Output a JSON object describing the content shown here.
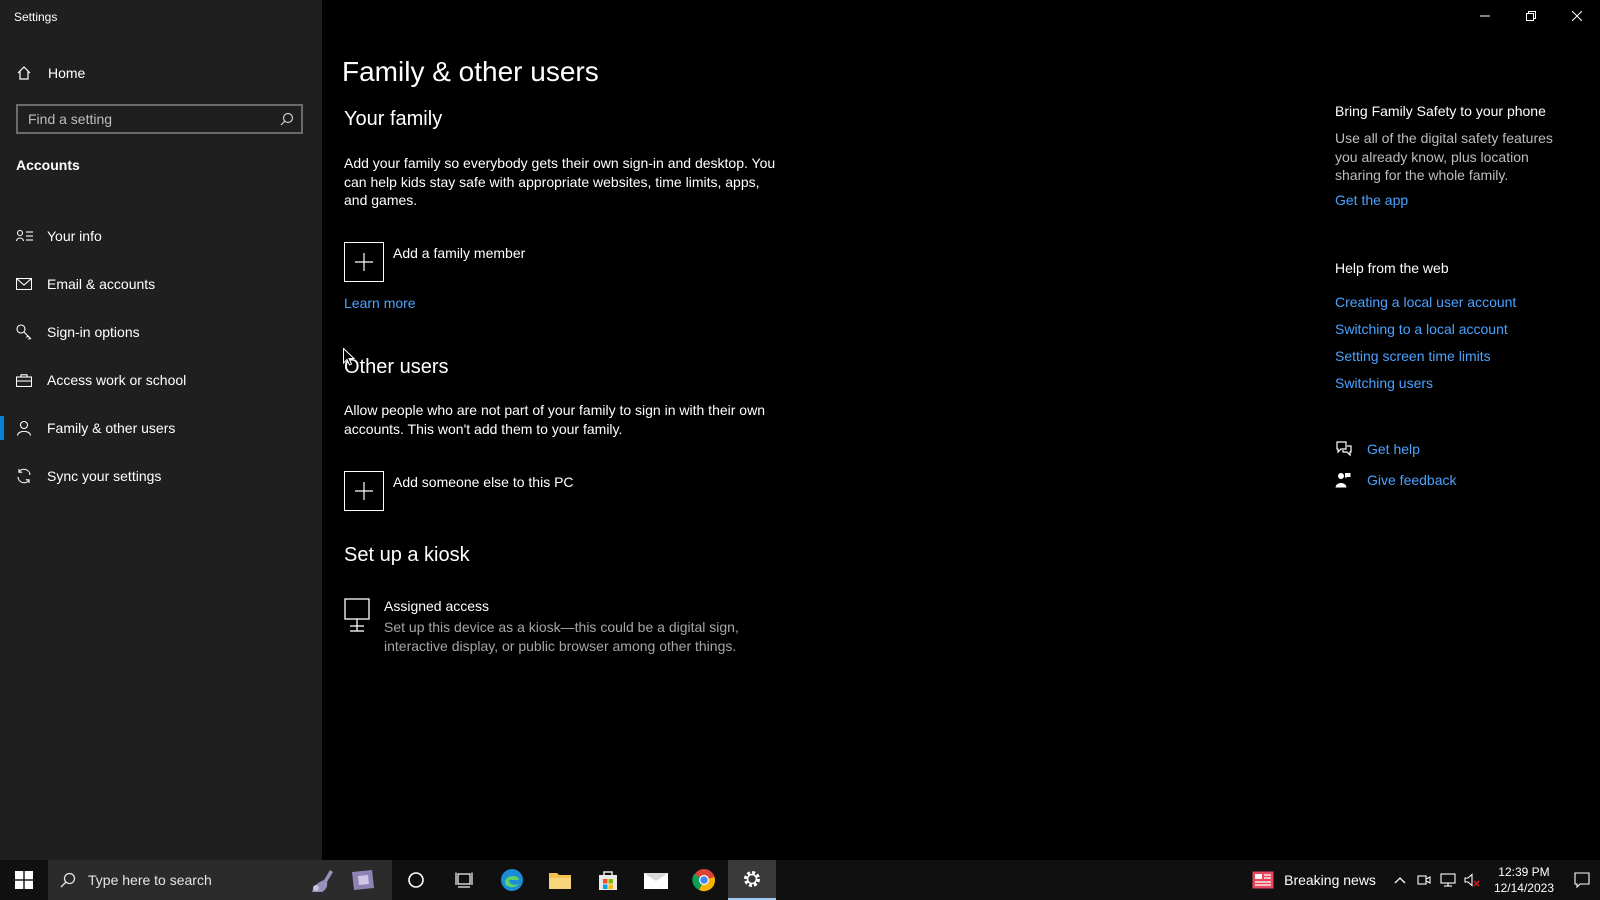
{
  "window": {
    "title": "Settings"
  },
  "sidebar": {
    "home_label": "Home",
    "search_placeholder": "Find a setting",
    "section_label": "Accounts",
    "items": [
      {
        "label": "Your info",
        "icon": "person-card-icon"
      },
      {
        "label": "Email & accounts",
        "icon": "envelope-icon"
      },
      {
        "label": "Sign-in options",
        "icon": "key-icon"
      },
      {
        "label": "Access work or school",
        "icon": "briefcase-icon"
      },
      {
        "label": "Family & other users",
        "icon": "person-icon",
        "active": true
      },
      {
        "label": "Sync your settings",
        "icon": "sync-icon"
      }
    ]
  },
  "main": {
    "title": "Family & other users",
    "family": {
      "heading": "Your family",
      "description": "Add your family so everybody gets their own sign-in and desktop. You can help kids stay safe with appropriate websites, time limits, apps, and games.",
      "add_label": "Add a family member",
      "learn_more": "Learn more"
    },
    "other": {
      "heading": "Other users",
      "description": "Allow people who are not part of your family to sign in with their own accounts. This won't add them to your family.",
      "add_label": "Add someone else to this PC"
    },
    "kiosk": {
      "heading": "Set up a kiosk",
      "title": "Assigned access",
      "description": "Set up this device as a kiosk—this could be a digital sign, interactive display, or public browser among other things."
    }
  },
  "right_panel": {
    "promo_heading": "Bring Family Safety to your phone",
    "promo_text": "Use all of the digital safety features you already know, plus location sharing for the whole family.",
    "promo_link": "Get the app",
    "help_heading": "Help from the web",
    "help_links": [
      "Creating a local user account",
      "Switching to a local account",
      "Setting screen time limits",
      "Switching users"
    ],
    "get_help": "Get help",
    "give_feedback": "Give feedback"
  },
  "taskbar": {
    "search_placeholder": "Type here to search",
    "news_label": "Breaking news",
    "time": "12:39 PM",
    "date": "12/14/2023",
    "accent": "#0a7fd6"
  }
}
